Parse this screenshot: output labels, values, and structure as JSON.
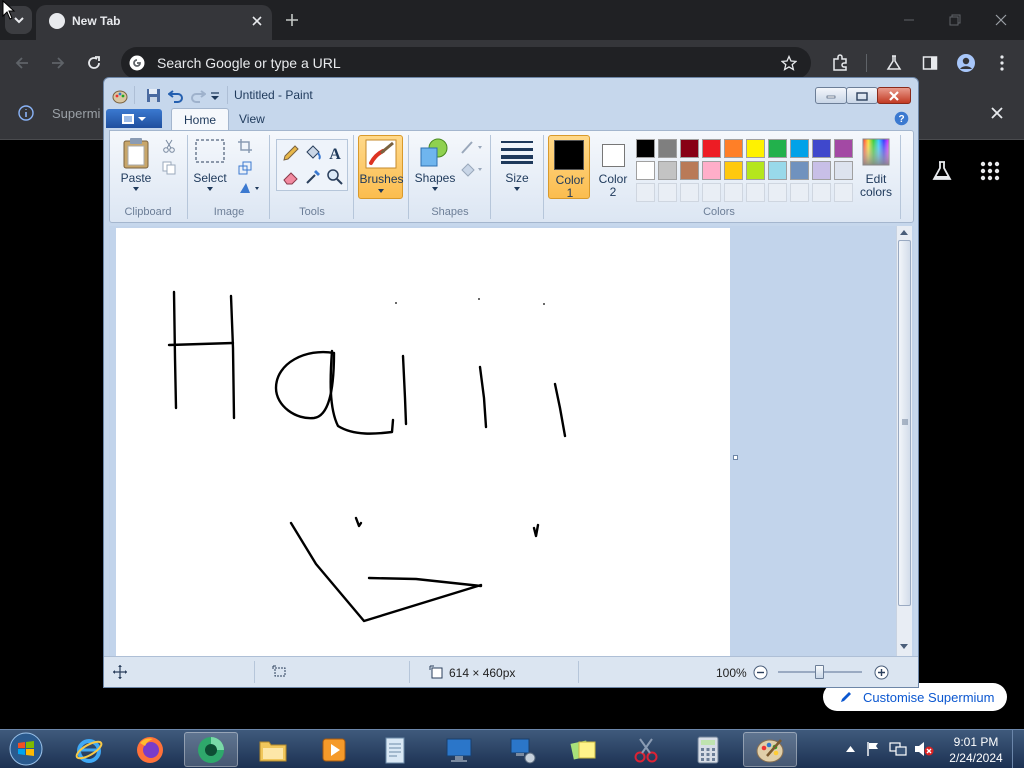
{
  "chrome": {
    "tab_title": "New Tab",
    "omnibox_placeholder": "Search Google or type a URL",
    "infobar_text": "Supermi",
    "customise_label": "Customise Supermium"
  },
  "paint": {
    "title": "Untitled - Paint",
    "tabs": [
      "Home",
      "View"
    ],
    "groups": {
      "clipboard": {
        "label": "Clipboard",
        "paste": "Paste"
      },
      "image": {
        "label": "Image",
        "select": "Select"
      },
      "tools": {
        "label": "Tools"
      },
      "brushes": "Brushes",
      "shapes": {
        "label": "Shapes",
        "button": "Shapes"
      },
      "size": "Size",
      "color1": [
        "Color",
        "1"
      ],
      "color2": [
        "Color",
        "2"
      ],
      "colors_label": "Colors",
      "edit_colors": [
        "Edit",
        "colors"
      ]
    },
    "palette_row1": [
      "#000000",
      "#7f7f7f",
      "#880015",
      "#ed1c24",
      "#ff7f27",
      "#fff200",
      "#22b14c",
      "#00a2e8",
      "#3f48cc",
      "#a349a4"
    ],
    "palette_row2": [
      "#ffffff",
      "#c3c3c3",
      "#b97a57",
      "#ffaec9",
      "#ffc90e",
      "#b5e61d",
      "#99d9ea",
      "#7092be",
      "#c8bfe7",
      "#dde3ee"
    ],
    "color1_value": "#000000",
    "color2_value": "#ffffff",
    "status": {
      "canvas_size": "614 × 460px",
      "zoom": "100%"
    }
  },
  "taskbar": {
    "time": "9:01 PM",
    "date": "2/24/2024"
  }
}
